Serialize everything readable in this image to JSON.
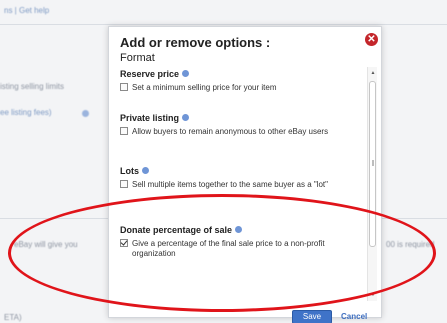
{
  "background": {
    "top_links": "ns | Get help",
    "selling_limits_text": "isting selling limits",
    "listing_fees_text": "ee listing fees)",
    "ebay_will_give_text": "eBay will give you",
    "required_text": "00 is required",
    "bottom_text": "ETA)"
  },
  "dialog": {
    "title": "Add or remove options :",
    "subtitle": "Format",
    "close_icon": "close-icon",
    "options": [
      {
        "heading": "Reserve price",
        "label": "Set a minimum selling price for your item",
        "checked": false
      },
      {
        "heading": "Private listing",
        "label": "Allow buyers to remain anonymous to other eBay users",
        "checked": false
      },
      {
        "heading": "Lots",
        "label": "Sell multiple items together to the same buyer as a \"lot\"",
        "checked": false
      },
      {
        "heading": "Donate percentage of sale",
        "label": "Give a percentage of the final sale price to a non-profit organization",
        "checked": true
      }
    ],
    "save_label": "Save",
    "cancel_label": "Cancel"
  },
  "colors": {
    "close": "#c4262b",
    "save": "#3f73c8",
    "link": "#3f6fc0",
    "annotation": "#e0141a"
  }
}
